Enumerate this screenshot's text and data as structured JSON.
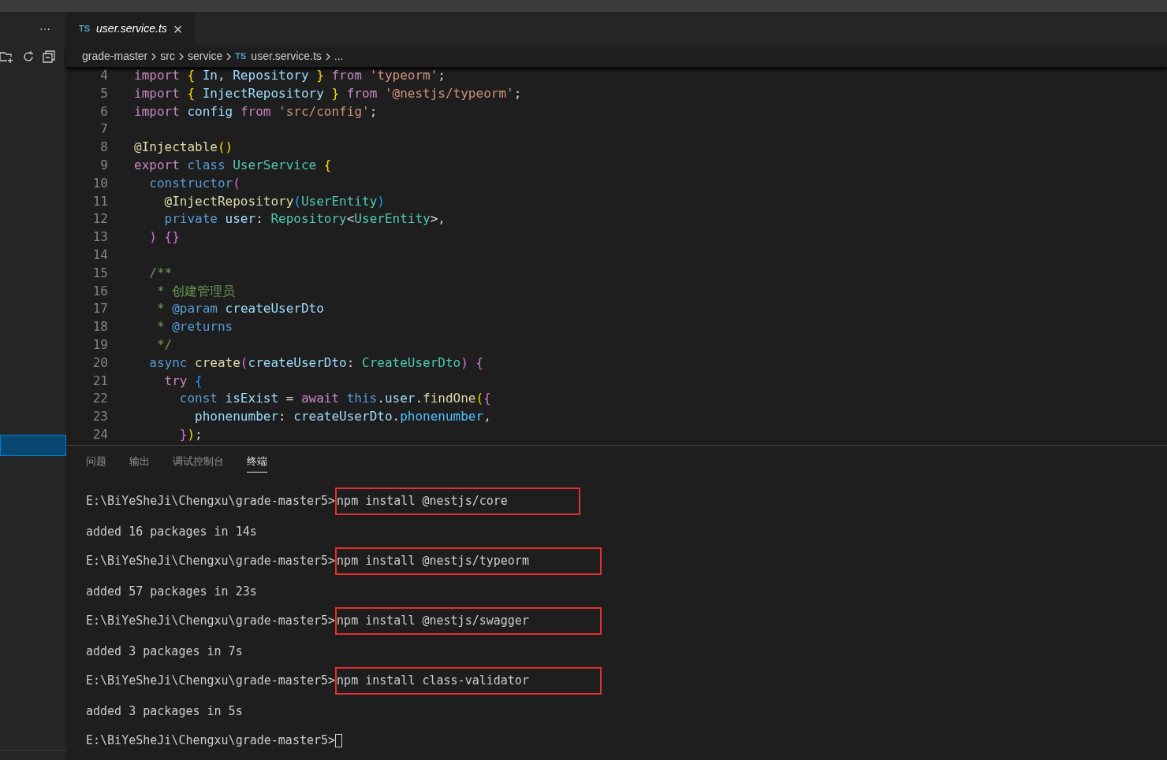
{
  "explorer": {
    "more": "···"
  },
  "tab": {
    "badge": "TS",
    "label": "user.service.ts",
    "close": "×",
    "selected": true
  },
  "breadcrumb": [
    {
      "label": "grade-master"
    },
    {
      "label": "src"
    },
    {
      "label": "service"
    },
    {
      "label": "user.service.ts",
      "badge": "TS"
    },
    {
      "label": "..."
    }
  ],
  "code_lines": [
    {
      "number": "4",
      "tokens": [
        {
          "text": "import ",
          "kind": "keyword"
        },
        {
          "text": "{ ",
          "kind": "bracket1"
        },
        {
          "text": "In",
          "kind": "variable"
        },
        {
          "text": ", ",
          "kind": "plain"
        },
        {
          "text": "Repository",
          "kind": "variable"
        },
        {
          "text": " } ",
          "kind": "bracket1"
        },
        {
          "text": "from ",
          "kind": "keyword"
        },
        {
          "text": "'typeorm'",
          "kind": "string"
        },
        {
          "text": ";",
          "kind": "plain"
        }
      ]
    },
    {
      "number": "5",
      "tokens": [
        {
          "text": "import ",
          "kind": "keyword"
        },
        {
          "text": "{ ",
          "kind": "bracket1"
        },
        {
          "text": "InjectRepository",
          "kind": "variable"
        },
        {
          "text": " } ",
          "kind": "bracket1"
        },
        {
          "text": "from ",
          "kind": "keyword"
        },
        {
          "text": "'@nestjs/typeorm'",
          "kind": "string"
        },
        {
          "text": ";",
          "kind": "plain"
        }
      ]
    },
    {
      "number": "6",
      "tokens": [
        {
          "text": "import ",
          "kind": "keyword"
        },
        {
          "text": "config ",
          "kind": "variable"
        },
        {
          "text": "from ",
          "kind": "keyword"
        },
        {
          "text": "'src/config'",
          "kind": "string"
        },
        {
          "text": ";",
          "kind": "plain"
        }
      ]
    },
    {
      "number": "7"
    },
    {
      "number": "8",
      "tokens": [
        {
          "text": "@Injectable",
          "kind": "function"
        },
        {
          "text": "()",
          "kind": "bracket1"
        }
      ]
    },
    {
      "number": "9",
      "tokens": [
        {
          "text": "export ",
          "kind": "keyword"
        },
        {
          "text": "class ",
          "kind": "storage"
        },
        {
          "text": "UserService ",
          "kind": "type"
        },
        {
          "text": "{",
          "kind": "bracket1"
        }
      ]
    },
    {
      "number": "10",
      "tokens": [
        {
          "text": "  constructor",
          "kind": "storage"
        },
        {
          "text": "(",
          "kind": "bracket2"
        }
      ]
    },
    {
      "number": "11",
      "tokens": [
        {
          "text": "    @InjectRepository",
          "kind": "function"
        },
        {
          "text": "(",
          "kind": "bracket3"
        },
        {
          "text": "UserEntity",
          "kind": "type"
        },
        {
          "text": ")",
          "kind": "bracket3"
        }
      ]
    },
    {
      "number": "12",
      "tokens": [
        {
          "text": "    private ",
          "kind": "storage"
        },
        {
          "text": "user",
          "kind": "variable"
        },
        {
          "text": ": ",
          "kind": "plain"
        },
        {
          "text": "Repository",
          "kind": "type"
        },
        {
          "text": "<",
          "kind": "plain"
        },
        {
          "text": "UserEntity",
          "kind": "type"
        },
        {
          "text": ">,",
          "kind": "plain"
        }
      ]
    },
    {
      "number": "13",
      "tokens": [
        {
          "text": "  )",
          "kind": "bracket2"
        },
        {
          "text": " {}",
          "kind": "bracket2"
        }
      ]
    },
    {
      "number": "14"
    },
    {
      "number": "15",
      "tokens": [
        {
          "text": "  /**",
          "kind": "comment"
        }
      ]
    },
    {
      "number": "16",
      "tokens": [
        {
          "text": "   * 创建管理员",
          "kind": "comment"
        }
      ]
    },
    {
      "number": "17",
      "tokens": [
        {
          "text": "   * ",
          "kind": "comment"
        },
        {
          "text": "@param ",
          "kind": "storage"
        },
        {
          "text": "createUserDto",
          "kind": "variable"
        }
      ]
    },
    {
      "number": "18",
      "tokens": [
        {
          "text": "   * ",
          "kind": "comment"
        },
        {
          "text": "@returns",
          "kind": "storage"
        }
      ]
    },
    {
      "number": "19",
      "tokens": [
        {
          "text": "   */",
          "kind": "comment"
        }
      ]
    },
    {
      "number": "20",
      "tokens": [
        {
          "text": "  async ",
          "kind": "storage"
        },
        {
          "text": "create",
          "kind": "function"
        },
        {
          "text": "(",
          "kind": "bracket2"
        },
        {
          "text": "createUserDto",
          "kind": "variable"
        },
        {
          "text": ": ",
          "kind": "plain"
        },
        {
          "text": "CreateUserDto",
          "kind": "type"
        },
        {
          "text": ")",
          "kind": "bracket2"
        },
        {
          "text": " {",
          "kind": "bracket2"
        }
      ]
    },
    {
      "number": "21",
      "tokens": [
        {
          "text": "    try ",
          "kind": "keyword"
        },
        {
          "text": "{",
          "kind": "bracket3"
        }
      ]
    },
    {
      "number": "22",
      "tokens": [
        {
          "text": "      const ",
          "kind": "storage"
        },
        {
          "text": "isExist ",
          "kind": "variable"
        },
        {
          "text": "= ",
          "kind": "plain"
        },
        {
          "text": "await ",
          "kind": "keyword"
        },
        {
          "text": "this",
          "kind": "storage"
        },
        {
          "text": ".",
          "kind": "plain"
        },
        {
          "text": "user",
          "kind": "variable"
        },
        {
          "text": ".",
          "kind": "plain"
        },
        {
          "text": "findOne",
          "kind": "function"
        },
        {
          "text": "(",
          "kind": "bracket1"
        },
        {
          "text": "{",
          "kind": "bracket2"
        }
      ]
    },
    {
      "number": "23",
      "tokens": [
        {
          "text": "        phonenumber",
          "kind": "variable"
        },
        {
          "text": ": ",
          "kind": "plain"
        },
        {
          "text": "createUserDto",
          "kind": "variable"
        },
        {
          "text": ".",
          "kind": "plain"
        },
        {
          "text": "phonenumber",
          "kind": "property"
        },
        {
          "text": ",",
          "kind": "plain"
        }
      ]
    },
    {
      "number": "24",
      "tokens": [
        {
          "text": "      }",
          "kind": "bracket2"
        },
        {
          "text": ")",
          "kind": "bracket1"
        },
        {
          "text": ";",
          "kind": "plain"
        }
      ]
    }
  ],
  "panel_tabs": [
    {
      "label": "问题",
      "selected": false
    },
    {
      "label": "输出",
      "selected": false
    },
    {
      "label": "调试控制台",
      "selected": false
    },
    {
      "label": "终端",
      "selected": true
    }
  ],
  "terminal_lines": [
    {
      "kind": "prompt",
      "path": "E:\\BiYeSheJi\\Chengxu\\grade-master5>",
      "command": "npm install @nestjs/core",
      "highlighted": true
    },
    {
      "kind": "output",
      "text": "added 16 packages in 14s"
    },
    {
      "kind": "prompt",
      "path": "E:\\BiYeSheJi\\Chengxu\\grade-master5>",
      "command": "npm install @nestjs/typeorm",
      "highlighted": true
    },
    {
      "kind": "output",
      "text": "added 57 packages in 23s"
    },
    {
      "kind": "prompt",
      "path": "E:\\BiYeSheJi\\Chengxu\\grade-master5>",
      "command": "npm install @nestjs/swagger",
      "highlighted": true
    },
    {
      "kind": "output",
      "text": "added 3 packages in 7s"
    },
    {
      "kind": "prompt",
      "path": "E:\\BiYeSheJi\\Chengxu\\grade-master5>",
      "command": "npm install class-validator",
      "highlighted": true
    },
    {
      "kind": "output",
      "text": "added 3 packages in 5s"
    },
    {
      "kind": "prompt",
      "path": "E:\\BiYeSheJi\\Chengxu\\grade-master5>",
      "cursor": true
    }
  ]
}
